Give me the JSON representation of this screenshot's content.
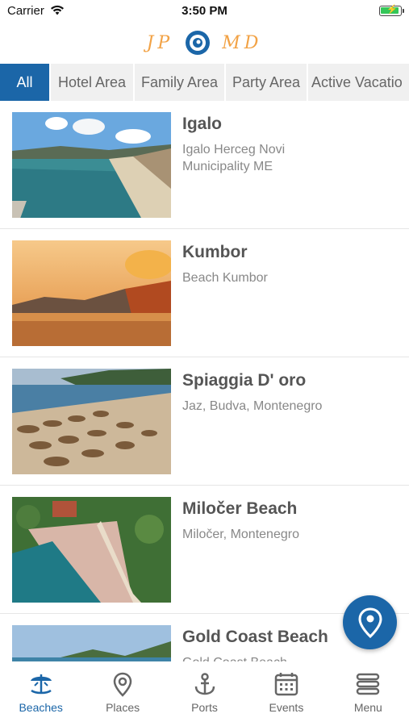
{
  "status": {
    "carrier": "Carrier",
    "time": "3:50 PM"
  },
  "logo": {
    "left": "JP",
    "right": "MD"
  },
  "tabs": [
    {
      "label": "All"
    },
    {
      "label": "Hotel Area"
    },
    {
      "label": "Family Area"
    },
    {
      "label": "Party Area"
    },
    {
      "label": "Active Vacatio"
    }
  ],
  "beaches": [
    {
      "title": "Igalo",
      "subtitle": "Igalo Herceg Novi Municipality ME"
    },
    {
      "title": "Kumbor",
      "subtitle": "Beach Kumbor"
    },
    {
      "title": "Spiaggia D' oro",
      "subtitle": "Jaz, Budva, Montenegro"
    },
    {
      "title": "Miločer Beach",
      "subtitle": "Miločer, Montenegro"
    },
    {
      "title": "Gold Coast Beach",
      "subtitle": "Gold Coast Beach, Montenegro"
    }
  ],
  "nav": [
    {
      "label": "Beaches",
      "icon": "umbrella-icon"
    },
    {
      "label": "Places",
      "icon": "location-pin-icon"
    },
    {
      "label": "Ports",
      "icon": "anchor-icon"
    },
    {
      "label": "Events",
      "icon": "calendar-icon"
    },
    {
      "label": "Menu",
      "icon": "menu-icon"
    }
  ],
  "colors": {
    "accent": "#1b66a8",
    "logo": "#f2a245"
  }
}
